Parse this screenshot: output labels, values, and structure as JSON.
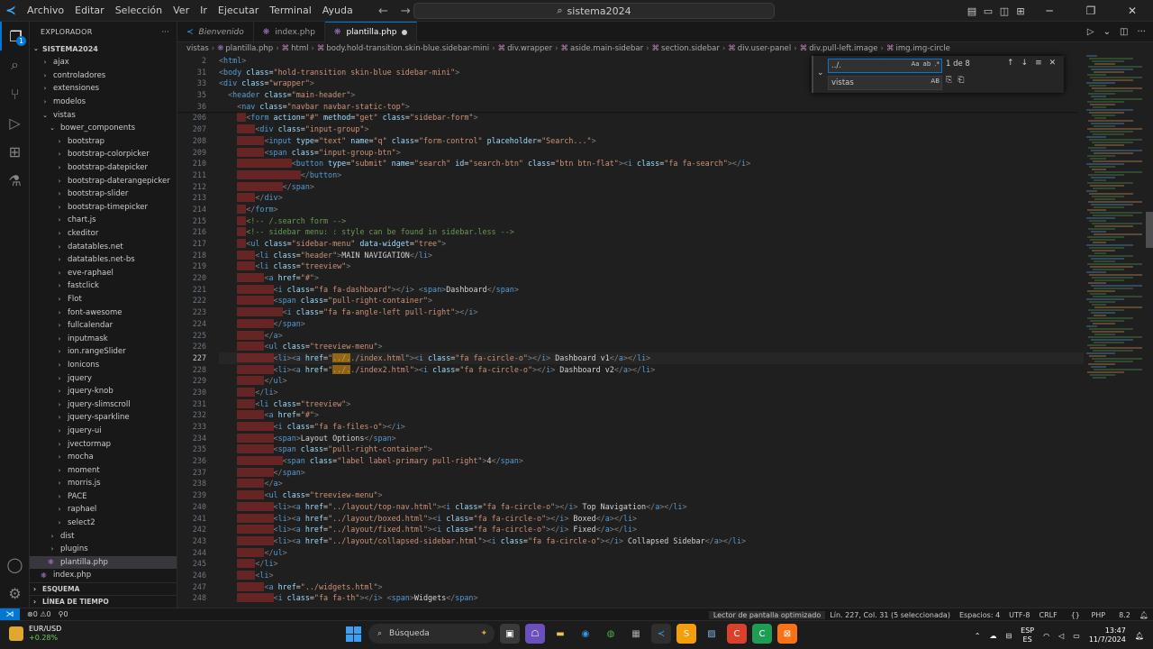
{
  "titlebar": {
    "menu": [
      "Archivo",
      "Editar",
      "Selección",
      "Ver",
      "Ir",
      "Ejecutar",
      "Terminal",
      "Ayuda"
    ],
    "search": "sistema2024"
  },
  "sidebar": {
    "header": "EXPLORADOR",
    "root": "SISTEMA2024",
    "items": [
      {
        "label": "ajax",
        "depth": 1,
        "chevron": "›"
      },
      {
        "label": "controladores",
        "depth": 1,
        "chevron": "›"
      },
      {
        "label": "extensiones",
        "depth": 1,
        "chevron": "›"
      },
      {
        "label": "modelos",
        "depth": 1,
        "chevron": "›"
      },
      {
        "label": "vistas",
        "depth": 1,
        "chevron": "⌄"
      },
      {
        "label": "bower_components",
        "depth": 2,
        "chevron": "⌄"
      },
      {
        "label": "bootstrap",
        "depth": 3,
        "chevron": "›"
      },
      {
        "label": "bootstrap-colorpicker",
        "depth": 3,
        "chevron": "›"
      },
      {
        "label": "bootstrap-datepicker",
        "depth": 3,
        "chevron": "›"
      },
      {
        "label": "bootstrap-daterangepicker",
        "depth": 3,
        "chevron": "›"
      },
      {
        "label": "bootstrap-slider",
        "depth": 3,
        "chevron": "›"
      },
      {
        "label": "bootstrap-timepicker",
        "depth": 3,
        "chevron": "›"
      },
      {
        "label": "chart.js",
        "depth": 3,
        "chevron": "›"
      },
      {
        "label": "ckeditor",
        "depth": 3,
        "chevron": "›"
      },
      {
        "label": "datatables.net",
        "depth": 3,
        "chevron": "›"
      },
      {
        "label": "datatables.net-bs",
        "depth": 3,
        "chevron": "›"
      },
      {
        "label": "eve-raphael",
        "depth": 3,
        "chevron": "›"
      },
      {
        "label": "fastclick",
        "depth": 3,
        "chevron": "›"
      },
      {
        "label": "Flot",
        "depth": 3,
        "chevron": "›"
      },
      {
        "label": "font-awesome",
        "depth": 3,
        "chevron": "›"
      },
      {
        "label": "fullcalendar",
        "depth": 3,
        "chevron": "›"
      },
      {
        "label": "inputmask",
        "depth": 3,
        "chevron": "›"
      },
      {
        "label": "ion.rangeSlider",
        "depth": 3,
        "chevron": "›"
      },
      {
        "label": "Ionicons",
        "depth": 3,
        "chevron": "›"
      },
      {
        "label": "jquery",
        "depth": 3,
        "chevron": "›"
      },
      {
        "label": "jquery-knob",
        "depth": 3,
        "chevron": "›"
      },
      {
        "label": "jquery-slimscroll",
        "depth": 3,
        "chevron": "›"
      },
      {
        "label": "jquery-sparkline",
        "depth": 3,
        "chevron": "›"
      },
      {
        "label": "jquery-ui",
        "depth": 3,
        "chevron": "›"
      },
      {
        "label": "jvectormap",
        "depth": 3,
        "chevron": "›"
      },
      {
        "label": "mocha",
        "depth": 3,
        "chevron": "›"
      },
      {
        "label": "moment",
        "depth": 3,
        "chevron": "›"
      },
      {
        "label": "morris.js",
        "depth": 3,
        "chevron": "›"
      },
      {
        "label": "PACE",
        "depth": 3,
        "chevron": "›"
      },
      {
        "label": "raphael",
        "depth": 3,
        "chevron": "›"
      },
      {
        "label": "select2",
        "depth": 3,
        "chevron": "›"
      },
      {
        "label": "dist",
        "depth": 2,
        "chevron": "›"
      },
      {
        "label": "plugins",
        "depth": 2,
        "chevron": "›"
      },
      {
        "label": "plantilla.php",
        "depth": 2,
        "chevron": "",
        "file": true,
        "selected": true
      },
      {
        "label": "index.php",
        "depth": 1,
        "chevron": "",
        "file": true
      }
    ],
    "sections": [
      "ESQUEMA",
      "LÍNEA DE TIEMPO"
    ]
  },
  "tabs": [
    {
      "label": "Bienvenido",
      "italic": true,
      "active": false
    },
    {
      "label": "index.php",
      "italic": false,
      "active": false
    },
    {
      "label": "plantilla.php",
      "italic": false,
      "active": true,
      "dirty": true
    }
  ],
  "breadcrumb": [
    "vistas",
    "plantilla.php",
    "html",
    "body.hold-transition.skin-blue.sidebar-mini",
    "div.wrapper",
    "aside.main-sidebar",
    "section.sidebar",
    "div.user-panel",
    "div.pull-left.image",
    "img.img-circle"
  ],
  "find": {
    "search_value": "../.",
    "replace_value": "vistas",
    "match_count": "1 de 8",
    "options": [
      "Aa",
      "ab",
      ".*"
    ],
    "replace_option": "AB"
  },
  "editor": {
    "current_line": 227,
    "sticky": [
      {
        "n": 2,
        "code": "<html>"
      },
      {
        "n": 31,
        "code": "<body class=\"hold-transition skin-blue sidebar-mini\">"
      },
      {
        "n": 33,
        "code": "<div class=\"wrapper\">"
      },
      {
        "n": 35,
        "code": "  <header class=\"main-header\">"
      },
      {
        "n": 36,
        "code": "    <nav class=\"navbar navbar-static-top\">"
      }
    ],
    "lines": [
      {
        "n": 206,
        "ind": 3,
        "code": "<form action=\"#\" method=\"get\" class=\"sidebar-form\">"
      },
      {
        "n": 207,
        "ind": 4,
        "code": "<div class=\"input-group\">"
      },
      {
        "n": 208,
        "ind": 5,
        "code": "<input type=\"text\" name=\"q\" class=\"form-control\" placeholder=\"Search...\">"
      },
      {
        "n": 209,
        "ind": 5,
        "code": "<span class=\"input-group-btn\">"
      },
      {
        "n": 210,
        "ind": 8,
        "code": "<button type=\"submit\" name=\"search\" id=\"search-btn\" class=\"btn btn-flat\"><i class=\"fa fa-search\"></i>"
      },
      {
        "n": 211,
        "ind": 9,
        "code": "</button>"
      },
      {
        "n": 212,
        "ind": 7,
        "code": "</span>"
      },
      {
        "n": 213,
        "ind": 4,
        "code": "</div>"
      },
      {
        "n": 214,
        "ind": 3,
        "code": "</form>"
      },
      {
        "n": 215,
        "ind": 3,
        "code": "<!-- /.search form -->"
      },
      {
        "n": 216,
        "ind": 3,
        "code": "<!-- sidebar menu: : style can be found in sidebar.less -->"
      },
      {
        "n": 217,
        "ind": 3,
        "code": "<ul class=\"sidebar-menu\" data-widget=\"tree\">"
      },
      {
        "n": 218,
        "ind": 4,
        "code": "<li class=\"header\">MAIN NAVIGATION</li>"
      },
      {
        "n": 219,
        "ind": 4,
        "code": "<li class=\"treeview\">"
      },
      {
        "n": 220,
        "ind": 5,
        "code": "<a href=\"#\">"
      },
      {
        "n": 221,
        "ind": 6,
        "code": "<i class=\"fa fa-dashboard\"></i> <span>Dashboard</span>"
      },
      {
        "n": 222,
        "ind": 6,
        "code": "<span class=\"pull-right-container\">"
      },
      {
        "n": 223,
        "ind": 7,
        "code": "<i class=\"fa fa-angle-left pull-right\"></i>"
      },
      {
        "n": 224,
        "ind": 6,
        "code": "</span>"
      },
      {
        "n": 225,
        "ind": 5,
        "code": "</a>"
      },
      {
        "n": 226,
        "ind": 5,
        "code": "<ul class=\"treeview-menu\">"
      },
      {
        "n": 227,
        "ind": 6,
        "code": "<li><a href=\"../../index.html\"><i class=\"fa fa-circle-o\"></i> Dashboard v1</a></li>",
        "hl": "../."
      },
      {
        "n": 228,
        "ind": 6,
        "code": "<li><a href=\"../../index2.html\"><i class=\"fa fa-circle-o\"></i> Dashboard v2</a></li>",
        "hl": "../."
      },
      {
        "n": 229,
        "ind": 5,
        "code": "</ul>"
      },
      {
        "n": 230,
        "ind": 4,
        "code": "</li>"
      },
      {
        "n": 231,
        "ind": 4,
        "code": "<li class=\"treeview\">"
      },
      {
        "n": 232,
        "ind": 5,
        "code": "<a href=\"#\">"
      },
      {
        "n": 233,
        "ind": 6,
        "code": "<i class=\"fa fa-files-o\"></i>"
      },
      {
        "n": 234,
        "ind": 6,
        "code": "<span>Layout Options</span>"
      },
      {
        "n": 235,
        "ind": 6,
        "code": "<span class=\"pull-right-container\">"
      },
      {
        "n": 236,
        "ind": 7,
        "code": "<span class=\"label label-primary pull-right\">4</span>"
      },
      {
        "n": 237,
        "ind": 6,
        "code": "</span>"
      },
      {
        "n": 238,
        "ind": 5,
        "code": "</a>"
      },
      {
        "n": 239,
        "ind": 5,
        "code": "<ul class=\"treeview-menu\">"
      },
      {
        "n": 240,
        "ind": 6,
        "code": "<li><a href=\"../layout/top-nav.html\"><i class=\"fa fa-circle-o\"></i> Top Navigation</a></li>"
      },
      {
        "n": 241,
        "ind": 6,
        "code": "<li><a href=\"../layout/boxed.html\"><i class=\"fa fa-circle-o\"></i> Boxed</a></li>"
      },
      {
        "n": 242,
        "ind": 6,
        "code": "<li><a href=\"../layout/fixed.html\"><i class=\"fa fa-circle-o\"></i> Fixed</a></li>"
      },
      {
        "n": 243,
        "ind": 6,
        "code": "<li><a href=\"../layout/collapsed-sidebar.html\"><i class=\"fa fa-circle-o\"></i> Collapsed Sidebar</a></li>"
      },
      {
        "n": 244,
        "ind": 5,
        "code": "</ul>"
      },
      {
        "n": 245,
        "ind": 4,
        "code": "</li>"
      },
      {
        "n": 246,
        "ind": 4,
        "code": "<li>"
      },
      {
        "n": 247,
        "ind": 5,
        "code": "<a href=\"../widgets.html\">"
      },
      {
        "n": 248,
        "ind": 6,
        "code": "<i class=\"fa fa-th\"></i> <span>Widgets</span>"
      }
    ]
  },
  "statusbar": {
    "errors": "0",
    "warnings": "0",
    "ports": "0",
    "screen_reader": "Lector de pantalla optimizado",
    "position": "Lín. 227, Col. 31 (5 seleccionada)",
    "spaces": "Espacios: 4",
    "encoding": "UTF-8",
    "eol": "CRLF",
    "language": "PHP",
    "version": "8.2"
  },
  "taskbar": {
    "weather_title": "EUR/USD",
    "weather_value": "+0.28%",
    "search_placeholder": "Búsqueda",
    "lang_top": "ESP",
    "lang_bottom": "ES",
    "time": "13:47",
    "date": "11/7/2024"
  },
  "colors": {
    "accent": "#0078d4",
    "tag": "#569cd6",
    "attr": "#9cdcfe",
    "string": "#ce9178",
    "comment": "#6a9955",
    "indent_error": "#a02828"
  }
}
